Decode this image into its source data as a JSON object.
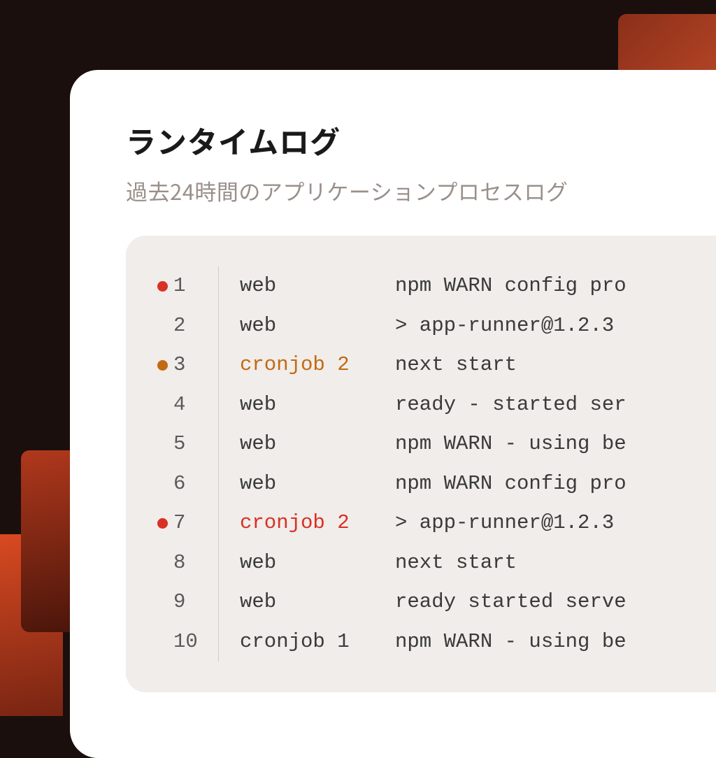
{
  "header": {
    "title": "ランタイムログ",
    "subtitle": "過去24時間のアプリケーションプロセスログ"
  },
  "colors": {
    "red": "#d93025",
    "orange": "#c26a12",
    "panel_bg": "#f0edea",
    "card_bg": "#ffffff",
    "page_bg": "#1a0f0d"
  },
  "logs": [
    {
      "n": "1",
      "dot": "red",
      "source": "web",
      "source_color": "",
      "msg": "npm WARN config pro"
    },
    {
      "n": "2",
      "dot": "",
      "source": "web",
      "source_color": "",
      "msg": "> app-runner@1.2.3 "
    },
    {
      "n": "3",
      "dot": "orange",
      "source": "cronjob 2",
      "source_color": "orange",
      "msg": "next start"
    },
    {
      "n": "4",
      "dot": "",
      "source": "web",
      "source_color": "",
      "msg": "ready - started ser"
    },
    {
      "n": "5",
      "dot": "",
      "source": "web",
      "source_color": "",
      "msg": "npm WARN - using be"
    },
    {
      "n": "6",
      "dot": "",
      "source": "web",
      "source_color": "",
      "msg": "npm WARN config pro"
    },
    {
      "n": "7",
      "dot": "red",
      "source": "cronjob 2",
      "source_color": "red",
      "msg": "> app-runner@1.2.3 "
    },
    {
      "n": "8",
      "dot": "",
      "source": "web",
      "source_color": "",
      "msg": "next start"
    },
    {
      "n": "9",
      "dot": "",
      "source": "web",
      "source_color": "",
      "msg": "ready started serve"
    },
    {
      "n": "10",
      "dot": "",
      "source": "cronjob 1",
      "source_color": "",
      "msg": "npm WARN - using be"
    }
  ]
}
